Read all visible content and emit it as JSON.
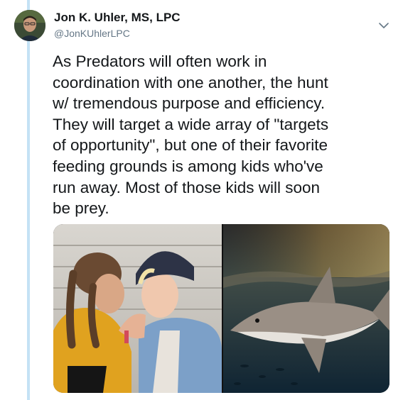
{
  "tweet": {
    "author": {
      "name": "Jon K. Uhler, MS, LPC",
      "handle": "@JonKUhlerLPC",
      "avatar_icon": "profile-photo"
    },
    "menu_icon": "chevron-down-icon",
    "text_lines": [
      "As Predators will often work in",
      "coordination with one another, the hunt",
      "w/ tremendous purpose and efficiency.",
      "They will target a wide array of \"targets",
      "of opportunity\", but one of their favorite",
      "feeding grounds is among kids who've",
      "run away. Most of those kids will soon",
      "be prey."
    ],
    "media": [
      {
        "icon": "photo-two-teen-girls"
      },
      {
        "icon": "photo-shark-underwater"
      }
    ]
  },
  "colors": {
    "thread_line": "#c4e2f5",
    "text": "#14171a",
    "secondary_text": "#657786"
  }
}
